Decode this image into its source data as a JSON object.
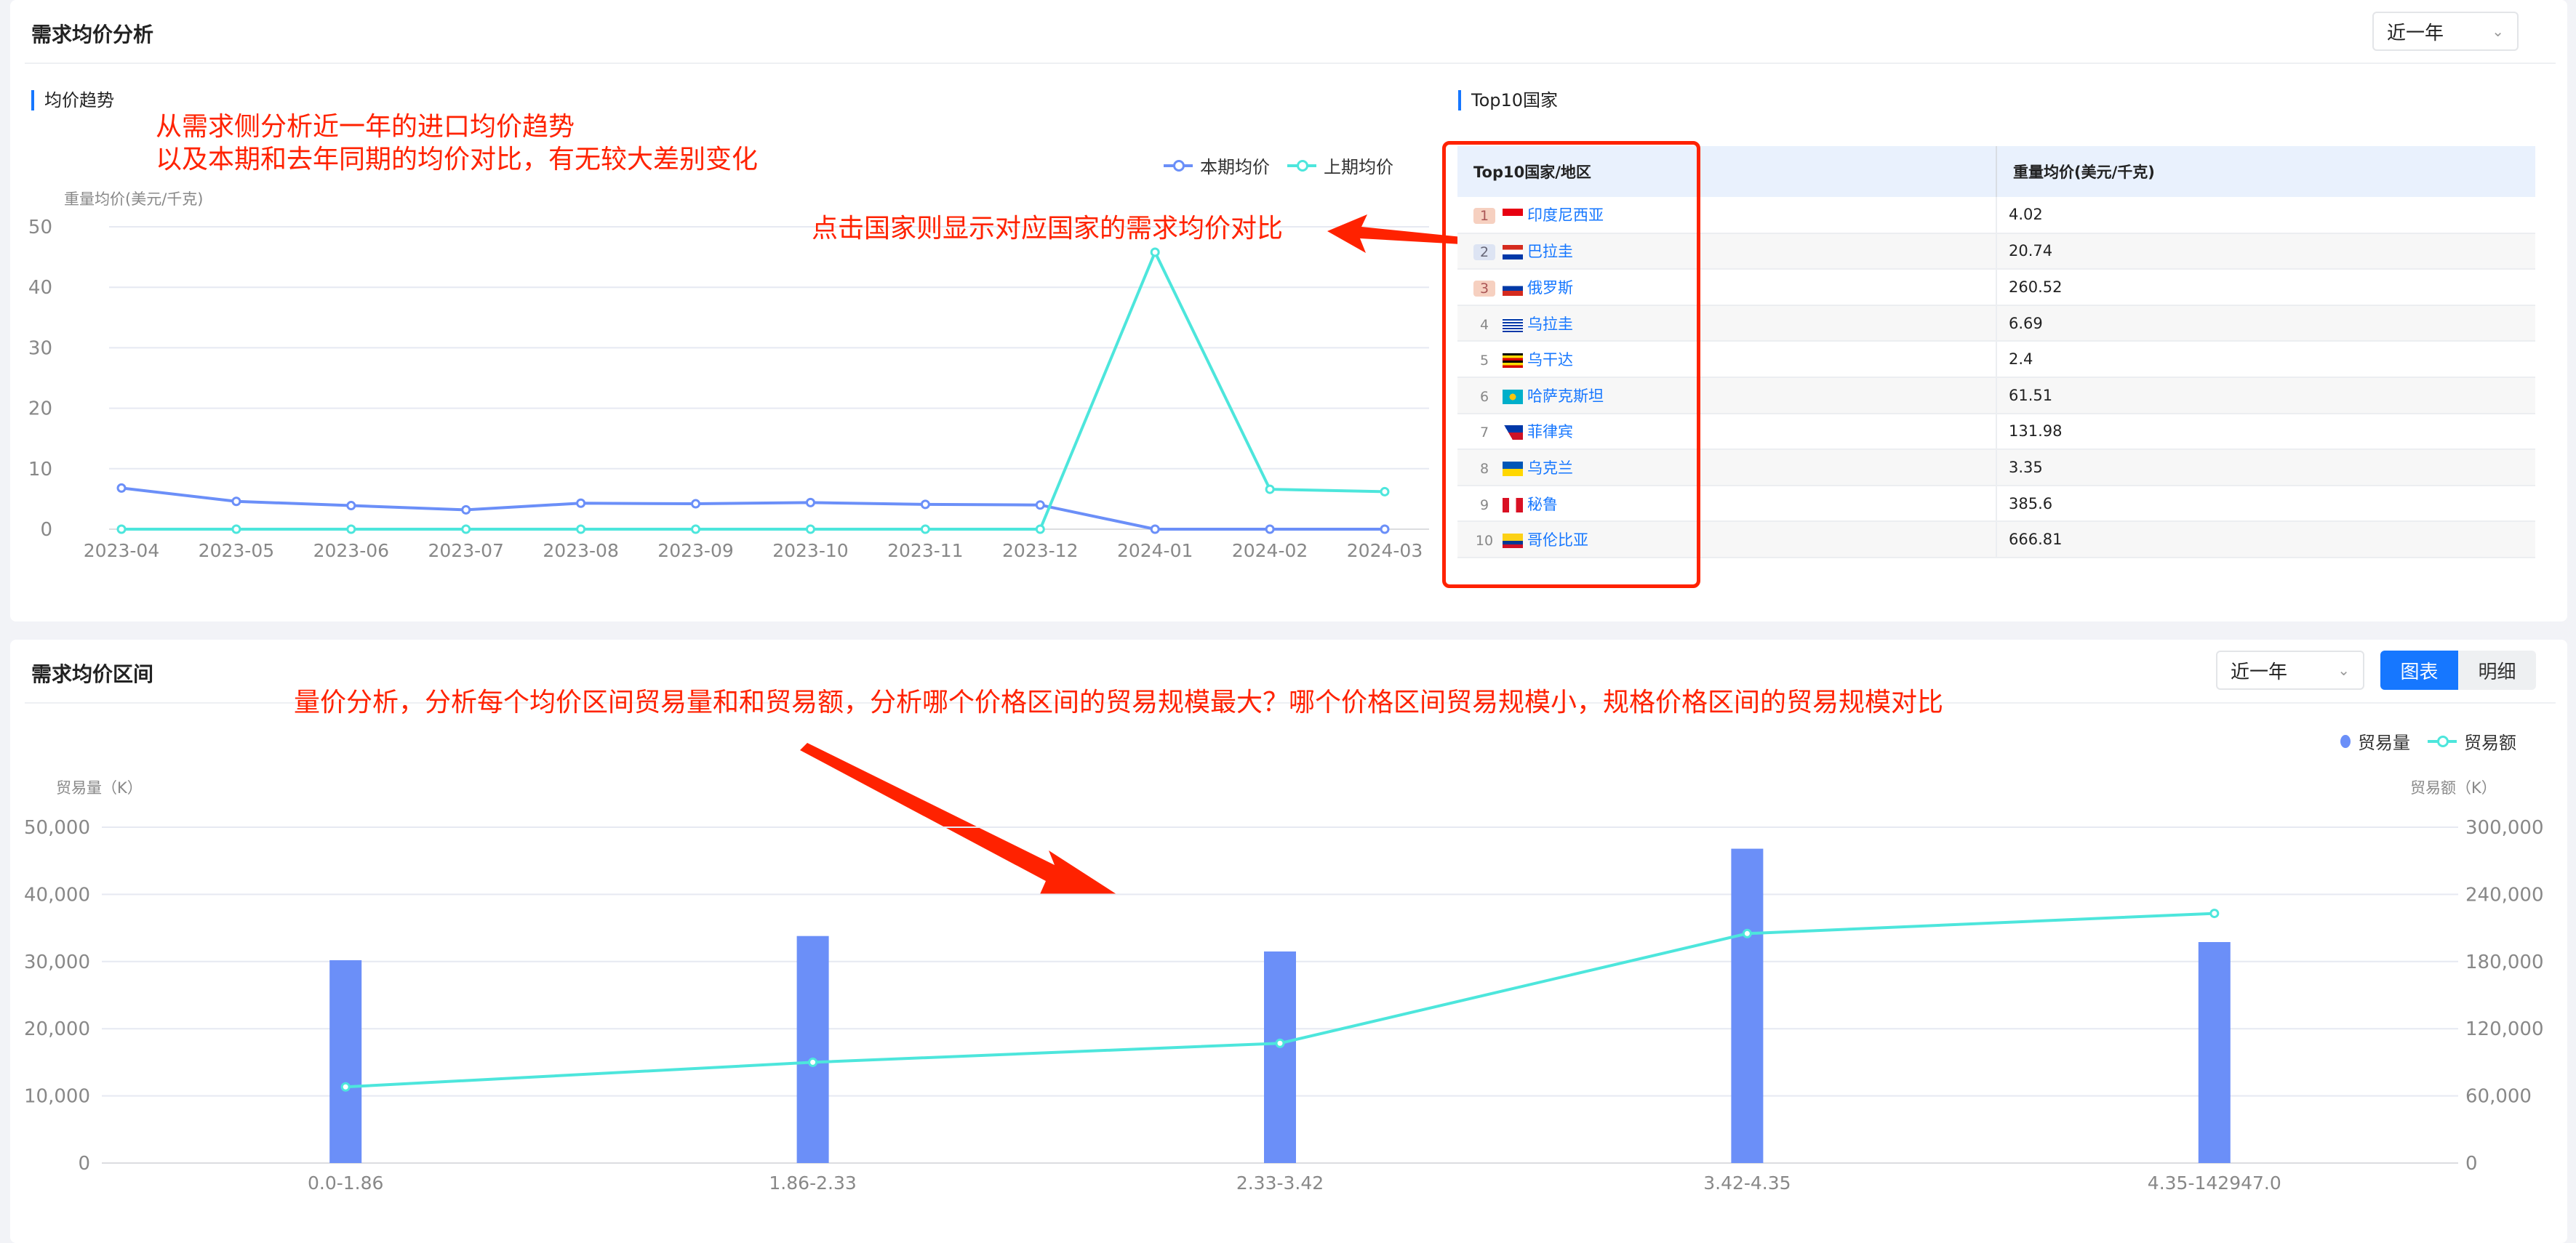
{
  "top_section": {
    "title": "需求均价分析",
    "period_select": "近一年",
    "trend": {
      "title": "均价趋势",
      "annotation_lines": [
        "从需求侧分析近一年的进口均价趋势",
        "以及本期和去年同期的均价对比，有无较大差别变化"
      ]
    },
    "top10": {
      "title": "Top10国家",
      "annotation": "点击国家则显示对应国家的需求均价对比",
      "columns": [
        "Top10国家/地区",
        "重量均价(美元/千克)"
      ],
      "rows": [
        {
          "rank": "1",
          "country": "印度尼西亚",
          "flag": "indonesia-flag",
          "value": "4.02"
        },
        {
          "rank": "2",
          "country": "巴拉圭",
          "flag": "paraguay-flag",
          "value": "20.74"
        },
        {
          "rank": "3",
          "country": "俄罗斯",
          "flag": "russia-flag",
          "value": "260.52"
        },
        {
          "rank": "4",
          "country": "乌拉圭",
          "flag": "uruguay-flag",
          "value": "6.69"
        },
        {
          "rank": "5",
          "country": "乌干达",
          "flag": "uganda-flag",
          "value": "2.4"
        },
        {
          "rank": "6",
          "country": "哈萨克斯坦",
          "flag": "kazakhstan-flag",
          "value": "61.51"
        },
        {
          "rank": "7",
          "country": "菲律宾",
          "flag": "philippines-flag",
          "value": "131.98"
        },
        {
          "rank": "8",
          "country": "乌克兰",
          "flag": "ukraine-flag",
          "value": "3.35"
        },
        {
          "rank": "9",
          "country": "秘鲁",
          "flag": "peru-flag",
          "value": "385.6"
        },
        {
          "rank": "10",
          "country": "哥伦比亚",
          "flag": "colombia-flag",
          "value": "666.81"
        }
      ]
    }
  },
  "bottom_section": {
    "title": "需求均价区间",
    "period_select": "近一年",
    "view_toggle": [
      "图表",
      "明细"
    ],
    "active_view": "图表",
    "annotation": "量价分析，分析每个均价区间贸易量和和贸易额，分析哪个价格区间的贸易规模最大？哪个价格区间贸易规模小，规格价格区间的贸易规模对比"
  },
  "chart_data": [
    {
      "type": "line",
      "ylabel": "重量均价(美元/千克)",
      "ylim": [
        0,
        50
      ],
      "yticks": [
        "0",
        "10",
        "20",
        "30",
        "40",
        "50"
      ],
      "categories": [
        "2023-04",
        "2023-05",
        "2023-06",
        "2023-07",
        "2023-08",
        "2023-09",
        "2023-10",
        "2023-11",
        "2023-12",
        "2024-01",
        "2024-02",
        "2024-03"
      ],
      "series": [
        {
          "name": "本期均价",
          "color": "#6b8ff8",
          "values": [
            6.8,
            4.6,
            3.9,
            3.2,
            4.3,
            4.2,
            4.4,
            4.1,
            4.0,
            0,
            0,
            0
          ]
        },
        {
          "name": "上期均价",
          "color": "#4de6dc",
          "values": [
            0,
            0,
            0,
            0,
            0,
            0,
            0,
            0,
            0,
            45.8,
            6.6,
            6.2
          ]
        }
      ],
      "grid": true,
      "legend": "top-right"
    },
    {
      "type": "bar+line",
      "ylabel_left": "贸易量（K）",
      "ylabel_right": "贸易额（K）",
      "ylim_left": [
        0,
        50000
      ],
      "ylim_right": [
        0,
        300000
      ],
      "yticks_left": [
        "0",
        "10,000",
        "20,000",
        "30,000",
        "40,000",
        "50,000"
      ],
      "yticks_right": [
        "0",
        "60,000",
        "120,000",
        "180,000",
        "240,000",
        "300,000"
      ],
      "categories": [
        "0.0-1.86",
        "1.86-2.33",
        "2.33-3.42",
        "3.42-4.35",
        "4.35-142947.0"
      ],
      "series": [
        {
          "name": "贸易量",
          "type": "bar",
          "axis": "left",
          "color": "#6b8ff8",
          "values": [
            30200,
            33800,
            31500,
            46800,
            32900
          ]
        },
        {
          "name": "贸易额",
          "type": "line",
          "axis": "right",
          "color": "#4de6dc",
          "values": [
            68000,
            90000,
            107000,
            205000,
            223000
          ]
        }
      ],
      "grid": true,
      "legend": "top-right"
    }
  ]
}
